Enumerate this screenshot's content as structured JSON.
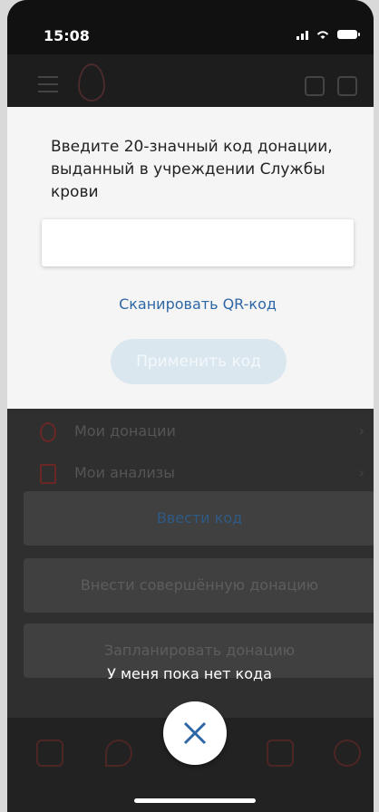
{
  "status_bar": {
    "time": "15:08"
  },
  "modal": {
    "title": "Введите 20-значный код донации, выданный в учреждении Службы крови",
    "input_value": "",
    "input_placeholder": "",
    "scan_link": "Сканировать QR-код",
    "apply_button": "Применить код"
  },
  "background_menu": [
    {
      "label": "Мои донации",
      "icon": "drop-icon"
    },
    {
      "label": "Мои анализы",
      "icon": "test-tube-icon"
    }
  ],
  "actions": {
    "enter_code": "Ввести код",
    "add_donation": "Внести совершённую донацию",
    "plan_donation": "Запланировать донацию"
  },
  "tooltip": "У меня пока нет кода",
  "colors": {
    "modal_bg": "#f5f5f5",
    "link": "#2e67a5",
    "disabled_button": "#dbe7ef",
    "accent": "#6b2626"
  },
  "icons": {
    "close": "close-icon",
    "tabs": [
      "blood-drop-tab-icon",
      "map-pin-tab-icon",
      "calendar-tab-icon",
      "profile-tab-icon"
    ]
  }
}
